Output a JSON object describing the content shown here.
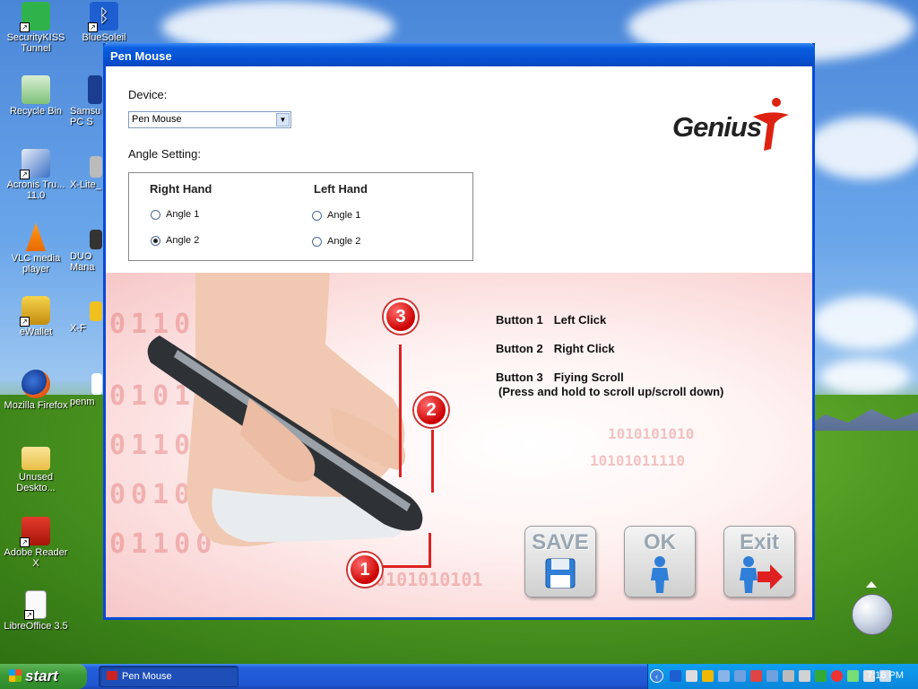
{
  "desktop": {
    "icons": [
      {
        "label": "SecurityKISS Tunnel",
        "icon": "securitykiss-icon"
      },
      {
        "label": "BlueSoleil",
        "icon": "bluetooth-icon"
      },
      {
        "label": "Recycle Bin",
        "icon": "recycle-bin-icon"
      },
      {
        "label": "Samsu PC S",
        "icon": "samsung-pc-studio-icon"
      },
      {
        "label": "Acronis Tru... 11.0",
        "icon": "acronis-icon"
      },
      {
        "label": "X-Lite_",
        "icon": "x-lite-icon"
      },
      {
        "label": "VLC media player",
        "icon": "vlc-icon"
      },
      {
        "label": "DUO Mana",
        "icon": "duo-manager-icon"
      },
      {
        "label": "eWallet",
        "icon": "ewallet-icon"
      },
      {
        "label": "X-F",
        "icon": "x-f-icon"
      },
      {
        "label": "Mozilla Firefox",
        "icon": "firefox-icon"
      },
      {
        "label": "penm",
        "icon": "penmouse-icon"
      },
      {
        "label": "Unused Deskto...",
        "icon": "folder-icon"
      },
      {
        "label": "Adobe Reader X",
        "icon": "adobe-reader-icon"
      },
      {
        "label": "LibreOffice 3.5",
        "icon": "libreoffice-icon"
      }
    ]
  },
  "window": {
    "title": "Pen Mouse",
    "device_label": "Device:",
    "device_value": "Pen Mouse",
    "angle_label": "Angle Setting:",
    "right_hand": {
      "label": "Right Hand",
      "options": [
        "Angle 1",
        "Angle 2"
      ],
      "selected": "Angle 2"
    },
    "left_hand": {
      "label": "Left Hand",
      "options": [
        "Angle 1",
        "Angle 2"
      ],
      "selected": ""
    },
    "brand": "Genius",
    "buttons_info": [
      {
        "button": "Button 1",
        "action": "Left Click"
      },
      {
        "button": "Button 2",
        "action": "Right Click"
      },
      {
        "button": "Button 3",
        "action": "Fiying Scroll"
      }
    ],
    "scroll_note": "(Press and hold to scroll up/scroll down)",
    "callouts": [
      "1",
      "2",
      "3"
    ],
    "actions": {
      "save": "SAVE",
      "ok": "OK",
      "exit": "Exit"
    },
    "binary_text": [
      "0110",
      "0101",
      "0110",
      "0010",
      "01100",
      "1010101010",
      "10101011110",
      "0101010101"
    ]
  },
  "taskbar": {
    "start_label": "start",
    "task_label": "Pen Mouse",
    "clock": "7:18 PM"
  },
  "colors": {
    "titlebar": "#0650d2",
    "accent_red": "#cc0000",
    "taskbar": "#245edb",
    "start_green": "#3c9a36"
  }
}
